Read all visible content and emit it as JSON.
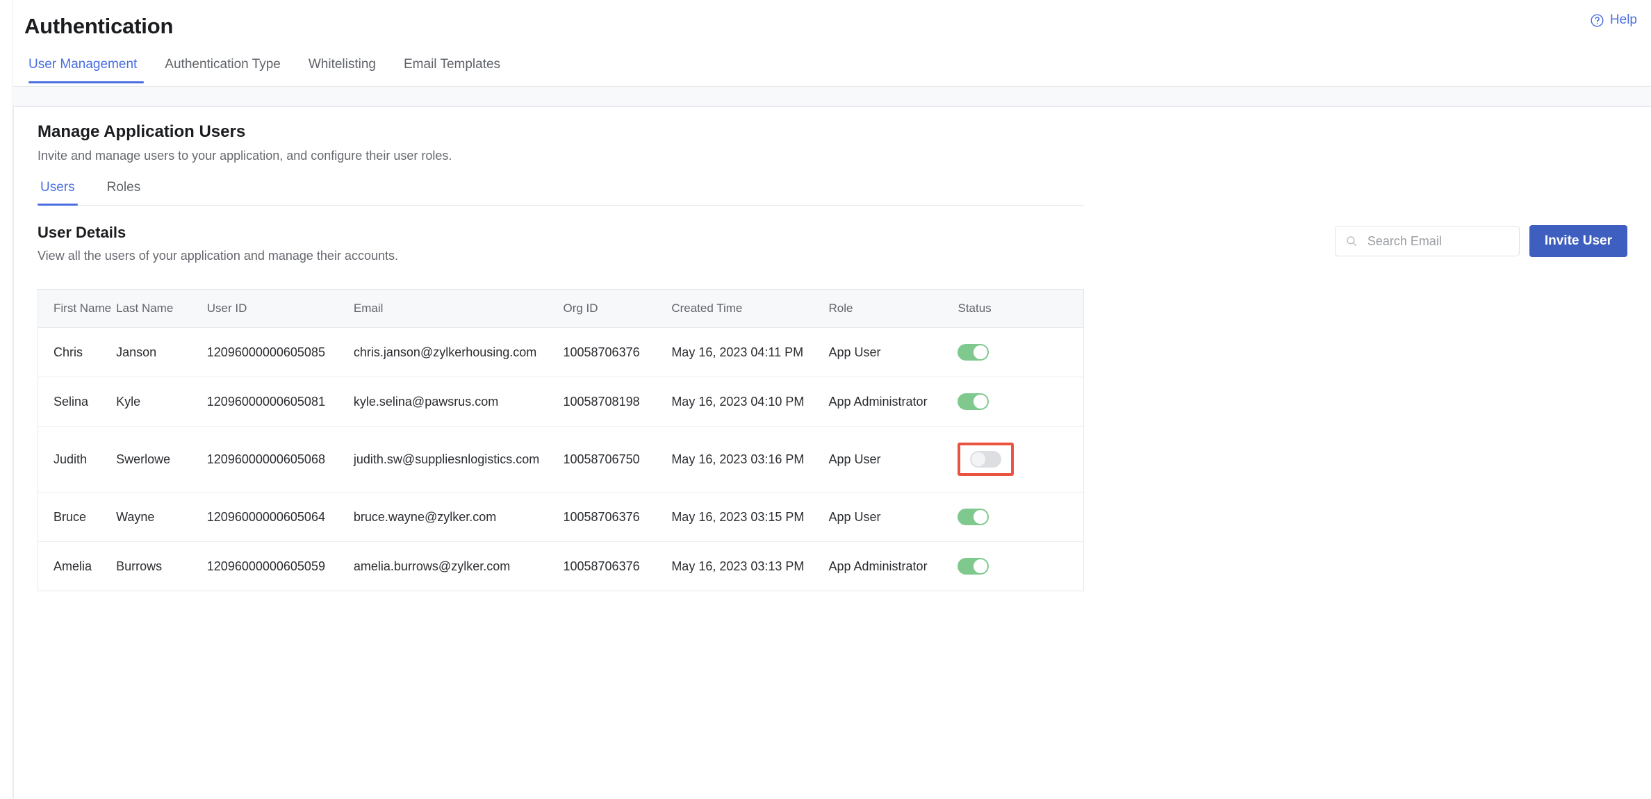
{
  "header": {
    "title": "Authentication",
    "help_label": "Help",
    "help_icon": "question-circle-icon"
  },
  "top_tabs": [
    {
      "label": "User Management",
      "active": true
    },
    {
      "label": "Authentication Type",
      "active": false
    },
    {
      "label": "Whitelisting",
      "active": false
    },
    {
      "label": "Email Templates",
      "active": false
    }
  ],
  "manage_section": {
    "title": "Manage Application Users",
    "subtitle": "Invite and manage users to your application, and configure their user roles."
  },
  "sub_tabs": [
    {
      "label": "Users",
      "active": true
    },
    {
      "label": "Roles",
      "active": false
    }
  ],
  "user_details": {
    "title": "User Details",
    "subtitle": "View all the users of your application and manage their accounts.",
    "search": {
      "placeholder": "Search Email",
      "value": "",
      "icon": "search-icon"
    },
    "invite_button": "Invite User"
  },
  "table": {
    "columns": [
      "First Name",
      "Last Name",
      "User ID",
      "Email",
      "Org ID",
      "Created Time",
      "Role",
      "Status"
    ],
    "rows": [
      {
        "first_name": "Chris",
        "last_name": "Janson",
        "user_id": "12096000000605085",
        "email": "chris.janson@zylkerhousing.com",
        "org_id": "10058706376",
        "created_time": "May 16, 2023 04:11 PM",
        "role": "App User",
        "status_on": true,
        "highlighted": false
      },
      {
        "first_name": "Selina",
        "last_name": "Kyle",
        "user_id": "12096000000605081",
        "email": "kyle.selina@pawsrus.com",
        "org_id": "10058708198",
        "created_time": "May 16, 2023 04:10 PM",
        "role": "App Administrator",
        "status_on": true,
        "highlighted": false
      },
      {
        "first_name": "Judith",
        "last_name": "Swerlowe",
        "user_id": "12096000000605068",
        "email": "judith.sw@suppliesnlogistics.com",
        "org_id": "10058706750",
        "created_time": "May 16, 2023 03:16 PM",
        "role": "App User",
        "status_on": false,
        "highlighted": true
      },
      {
        "first_name": "Bruce",
        "last_name": "Wayne",
        "user_id": "12096000000605064",
        "email": "bruce.wayne@zylker.com",
        "org_id": "10058706376",
        "created_time": "May 16, 2023 03:15 PM",
        "role": "App User",
        "status_on": true,
        "highlighted": false
      },
      {
        "first_name": "Amelia",
        "last_name": "Burrows",
        "user_id": "12096000000605059",
        "email": "amelia.burrows@zylker.com",
        "org_id": "10058706376",
        "created_time": "May 16, 2023 03:13 PM",
        "role": "App Administrator",
        "status_on": true,
        "highlighted": false
      }
    ]
  },
  "colors": {
    "accent_blue": "#4a6ee0",
    "button_blue": "#3f5fc0",
    "toggle_on_green": "#7fc98f",
    "toggle_off_gray": "#dcdee1",
    "highlight_red": "#e8543f"
  }
}
